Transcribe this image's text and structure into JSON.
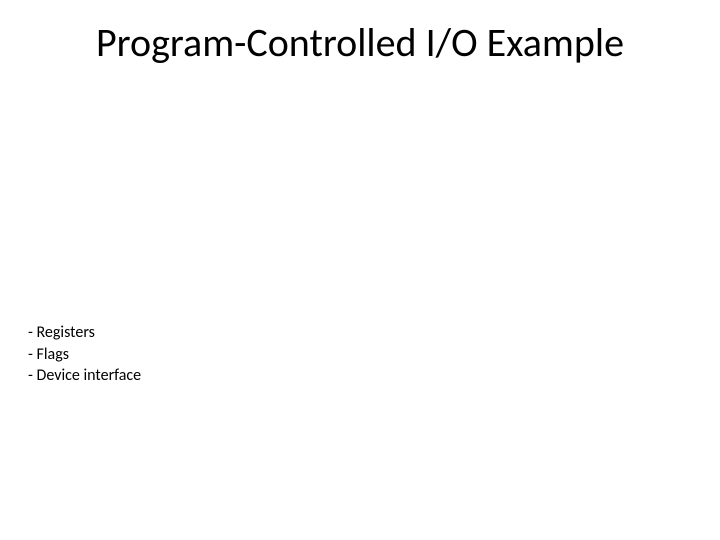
{
  "slide": {
    "title": "Program-Controlled I/O Example",
    "bullets": [
      "- Registers",
      "- Flags",
      "- Device interface"
    ]
  }
}
